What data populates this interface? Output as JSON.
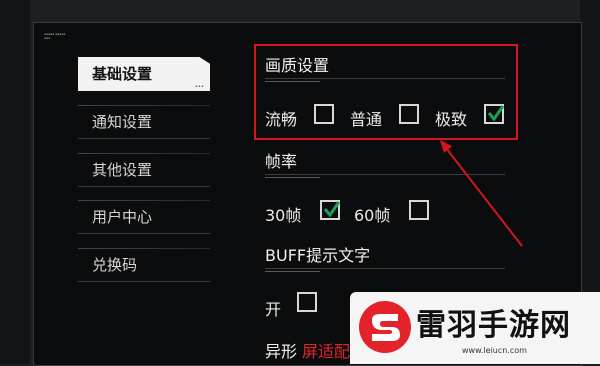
{
  "sidebar": {
    "items": [
      {
        "label": "基础设置",
        "active": true
      },
      {
        "label": "通知设置"
      },
      {
        "label": "其他设置"
      },
      {
        "label": "用户中心"
      },
      {
        "label": "兑换码"
      }
    ],
    "active_dots": "..."
  },
  "quality": {
    "title": "画质设置",
    "options": [
      {
        "label": "流畅",
        "checked": false
      },
      {
        "label": "普通",
        "checked": false
      },
      {
        "label": "极致",
        "checked": true
      }
    ]
  },
  "framerate": {
    "title": "帧率",
    "options": [
      {
        "label": "30帧",
        "checked": true
      },
      {
        "label": "60帧",
        "checked": false
      }
    ]
  },
  "buff": {
    "title": "BUFF提示文字",
    "options": [
      {
        "label": "开",
        "checked": false
      }
    ]
  },
  "next_section": {
    "title_prefix": "异形",
    "title_suffix": "屏适配"
  },
  "watermark": {
    "name": "雷羽手游网",
    "url": "www.leiucn.com"
  },
  "colors": {
    "highlight": "#d6161c",
    "check": "#1f9e57",
    "accent_active": "#f2f2f2"
  }
}
